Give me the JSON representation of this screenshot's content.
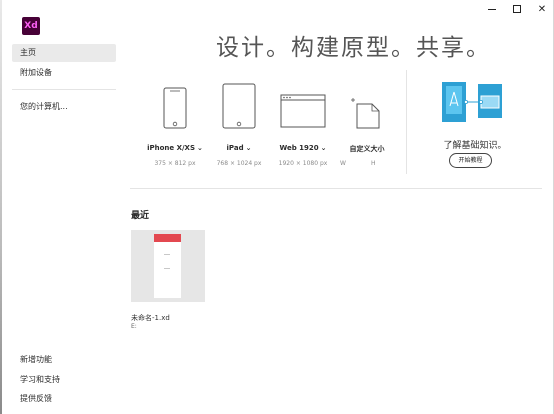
{
  "window": {
    "minimize_icon": "minimize-icon",
    "maximize_icon": "maximize-icon",
    "close_icon": "close-icon",
    "close_glyph": "✕"
  },
  "app": {
    "logo_text": "Xd",
    "accent": "#470137",
    "logo_text_color": "#ff61f6"
  },
  "sidebar": {
    "items": [
      {
        "label": "主页",
        "active": true
      },
      {
        "label": "附加设备",
        "active": false
      },
      {
        "label": "您的计算机...",
        "active": false
      }
    ],
    "footer": [
      {
        "label": "新增功能"
      },
      {
        "label": "学习和支持"
      },
      {
        "label": "提供反馈"
      }
    ]
  },
  "main": {
    "headline": "设计。构建原型。共享。",
    "templates": [
      {
        "name": "iPhone X/XS",
        "size": "375 × 812 px",
        "icon": "phone-icon"
      },
      {
        "name": "iPad",
        "size": "768 × 1024 px",
        "icon": "tablet-icon"
      },
      {
        "name": "Web 1920",
        "size": "1920 × 1080 px",
        "icon": "browser-icon"
      },
      {
        "name": "自定义大小",
        "w_label": "W",
        "h_label": "H",
        "icon": "custom-size-icon"
      }
    ],
    "learn": {
      "title": "了解基础知识。",
      "button": "开始教程",
      "illustration": "tutorial-illustration"
    },
    "recent": {
      "title": "最近",
      "files": [
        {
          "name": "未命名-1.xd",
          "sub": "E:"
        }
      ]
    }
  }
}
